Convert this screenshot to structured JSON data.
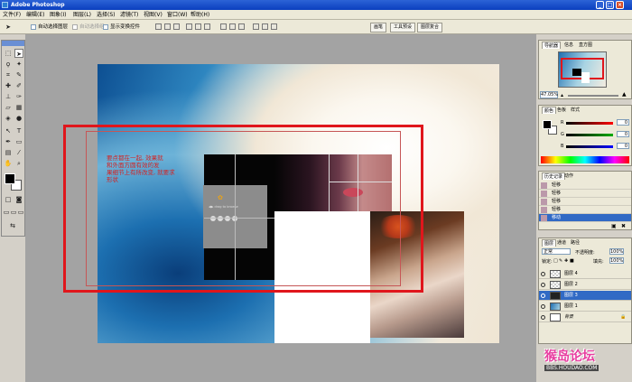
{
  "app": {
    "title": "Adobe Photoshop",
    "window_buttons": [
      "_",
      "□",
      "×"
    ]
  },
  "menubar": {
    "items": [
      "文件(F)",
      "编辑(E)",
      "图象(I)",
      "图层(L)",
      "选择(S)",
      "滤镜(T)",
      "视图(V)",
      "窗口(W)",
      "帮助(H)"
    ]
  },
  "options": {
    "auto_select_layer": "自动选择图层",
    "auto_select_group": "自动选择组",
    "show_transform": "显示变换控件",
    "tabs": [
      "画笔",
      "工具预设",
      "图层复合"
    ]
  },
  "document": {
    "text_lines": [
      "要点都在一起, 效果就",
      "和外面方圆有效的发",
      "果细节上有所改变, 就要求",
      "形状"
    ],
    "small_caption": "◀▶ drag to browse"
  },
  "navigator": {
    "tabs": [
      "导航器",
      "信息",
      "直方图"
    ],
    "zoom": "47.05%"
  },
  "color": {
    "tabs": [
      "颜色",
      "色板",
      "样式"
    ],
    "channels": [
      {
        "label": "R",
        "value": "0",
        "color": "#d42a2a"
      },
      {
        "label": "G",
        "value": "0",
        "color": "#2aa82a"
      },
      {
        "label": "B",
        "value": "0",
        "color": "#2a4ad4"
      }
    ]
  },
  "history": {
    "tabs": [
      "历史记录",
      "动作"
    ],
    "items": [
      "轻移",
      "轻移",
      "轻移",
      "轻移",
      "移动"
    ]
  },
  "layers": {
    "tabs": [
      "图层",
      "通道",
      "路径"
    ],
    "blend_mode": "正常",
    "opacity_label": "不透明度:",
    "opacity": "100%",
    "lock_label": "锁定:",
    "fill_label": "填充:",
    "fill": "100%",
    "items": [
      {
        "name": "图层 4",
        "selected": false
      },
      {
        "name": "图层 2",
        "selected": false
      },
      {
        "name": "图层 3",
        "selected": true
      },
      {
        "name": "图层 1",
        "selected": false
      },
      {
        "name": "背景",
        "selected": false
      }
    ]
  },
  "watermark": {
    "main": "猴岛论坛",
    "url": "BBS.HOUDAO.COM"
  },
  "colors": {
    "selection_red": "#e0161c",
    "selected_row": "#316ac5"
  }
}
